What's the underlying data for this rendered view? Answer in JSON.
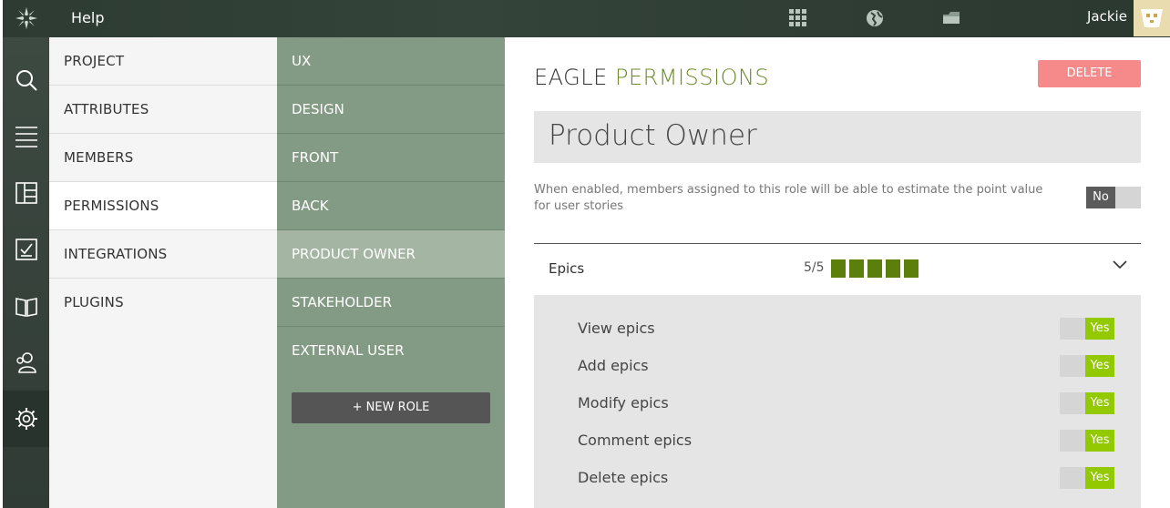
{
  "topbar": {
    "help_label": "Help",
    "user_name": "Jackie",
    "icons": [
      "taiga-logo-icon",
      "apps-grid-icon",
      "globe-icon",
      "folder-icon"
    ]
  },
  "iconbar": {
    "items": [
      "search-icon",
      "menu-icon",
      "kanban-icon",
      "issues-icon",
      "wiki-icon",
      "team-icon",
      "settings-icon"
    ]
  },
  "admin_menu": {
    "items": [
      {
        "label": "PROJECT"
      },
      {
        "label": "ATTRIBUTES"
      },
      {
        "label": "MEMBERS"
      },
      {
        "label": "PERMISSIONS"
      },
      {
        "label": "INTEGRATIONS"
      },
      {
        "label": "PLUGINS"
      }
    ],
    "active": "PERMISSIONS"
  },
  "roles_menu": {
    "items": [
      {
        "label": "UX"
      },
      {
        "label": "DESIGN"
      },
      {
        "label": "FRONT"
      },
      {
        "label": "BACK"
      },
      {
        "label": "PRODUCT OWNER"
      },
      {
        "label": "STAKEHOLDER"
      },
      {
        "label": "EXTERNAL USER"
      }
    ],
    "active": "PRODUCT OWNER",
    "new_role_label": "+ NEW ROLE"
  },
  "main": {
    "title_project": "EAGLE",
    "title_section": "PERMISSIONS",
    "delete_label": "DELETE",
    "role_name": "Product Owner",
    "estimate_hint": "When enabled, members assigned to this role will be able to estimate the point value for user stories",
    "estimate_toggle": "No",
    "epics": {
      "label": "Epics",
      "count": "5/5",
      "enabled": 5,
      "permissions": [
        {
          "label": "View epics",
          "value": "Yes"
        },
        {
          "label": "Add epics",
          "value": "Yes"
        },
        {
          "label": "Modify epics",
          "value": "Yes"
        },
        {
          "label": "Comment epics",
          "value": "Yes"
        },
        {
          "label": "Delete epics",
          "value": "Yes"
        }
      ]
    }
  },
  "colors": {
    "accent_green": "#6c8a2a",
    "toggle_yes": "#92c900",
    "toggle_no": "#5b5b5b",
    "delete_button": "#f68a8a",
    "roles_bg": "#839b84"
  }
}
